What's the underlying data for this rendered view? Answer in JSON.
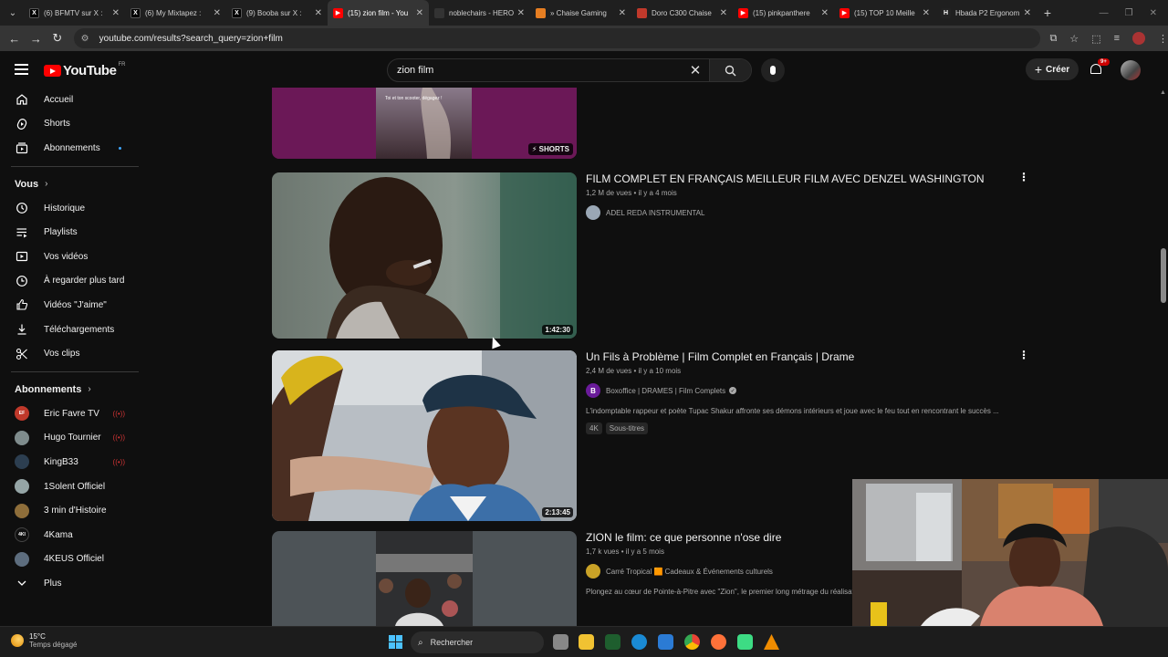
{
  "browser": {
    "tabs": [
      {
        "title": "(6) BFMTV sur X :",
        "icon": "x-icon",
        "active": false
      },
      {
        "title": "(6) My Mixtapez :",
        "icon": "x-icon",
        "active": false
      },
      {
        "title": "(9) Booba sur X :",
        "icon": "x-icon",
        "active": false
      },
      {
        "title": "(15) zion film - You",
        "icon": "youtube-icon",
        "active": true
      },
      {
        "title": "noblechairs - HERO",
        "icon": "noblechairs-icon",
        "active": false
      },
      {
        "title": "» Chaise Gaming",
        "icon": "chaise-gaming-icon",
        "active": false
      },
      {
        "title": "Doro C300 Chaise",
        "icon": "doro-icon",
        "active": false
      },
      {
        "title": "(15) pinkpanthere",
        "icon": "youtube-icon",
        "active": false
      },
      {
        "title": "(15) TOP 10 Meille",
        "icon": "youtube-icon",
        "active": false
      },
      {
        "title": "Hbada P2 Ergonom",
        "icon": "hbada-icon",
        "active": false
      }
    ],
    "url": "youtube.com/results?search_query=zion+film"
  },
  "header": {
    "logo_text": "YouTube",
    "country": "FR",
    "search_value": "zion film",
    "create_label": "Créer",
    "notifications_badge": "9+"
  },
  "sidebar": {
    "main": [
      {
        "label": "Accueil",
        "icon": "home-icon"
      },
      {
        "label": "Shorts",
        "icon": "shorts-icon"
      },
      {
        "label": "Abonnements",
        "icon": "subscriptions-icon"
      }
    ],
    "you_heading": "Vous",
    "you_items": [
      {
        "label": "Historique",
        "icon": "history-icon"
      },
      {
        "label": "Playlists",
        "icon": "playlists-icon"
      },
      {
        "label": "Vos vidéos",
        "icon": "your-videos-icon"
      },
      {
        "label": "À regarder plus tard",
        "icon": "watch-later-icon"
      },
      {
        "label": "Vidéos \"J'aime\"",
        "icon": "liked-videos-icon"
      },
      {
        "label": "Téléchargements",
        "icon": "downloads-icon"
      },
      {
        "label": "Vos clips",
        "icon": "clips-icon"
      }
    ],
    "subs_heading": "Abonnements",
    "subscriptions": [
      {
        "label": "Eric Favre TV",
        "live": true,
        "avatar_color": "#c0392b",
        "avatar_text": "EF"
      },
      {
        "label": "Hugo Tournier",
        "live": true,
        "avatar_color": "#7f8c8d",
        "avatar_text": ""
      },
      {
        "label": "KingB33",
        "live": true,
        "avatar_color": "#2c3e50",
        "avatar_text": ""
      },
      {
        "label": "1Solent Officiel",
        "live": false,
        "avatar_color": "#95a5a6",
        "avatar_text": ""
      },
      {
        "label": "3 min d'Histoire",
        "live": false,
        "avatar_color": "#8e6e3a",
        "avatar_text": ""
      },
      {
        "label": "4Kama",
        "live": false,
        "avatar_color": "#111111",
        "avatar_text": "4KI"
      },
      {
        "label": "4KEUS Officiel",
        "live": false,
        "avatar_color": "#5d6d7e",
        "avatar_text": ""
      }
    ],
    "more_label": "Plus"
  },
  "results": [
    {
      "kind": "short",
      "shorts_label": "SHORTS",
      "overlay_text": "Toi et ton scooter, dégagez !"
    },
    {
      "title": "FILM COMPLET EN FRANÇAIS MEILLEUR FILM AVEC DENZEL WASHINGTON",
      "views": "1,2 M de vues",
      "age": "il y a 4 mois",
      "channel": "ADEL REDA INSTRUMENTAL",
      "verified": false,
      "channel_color": "#9aa7b5",
      "channel_initial": "",
      "duration": "1:42:30",
      "description": "",
      "chips": []
    },
    {
      "title": "Un Fils à Problème | Film Complet en Français | Drame",
      "views": "2,4 M de vues",
      "age": "il y a 10 mois",
      "channel": "Boxoffice | DRAMES | Film Complets",
      "verified": true,
      "channel_color": "#6a1b9a",
      "channel_initial": "B",
      "duration": "2:13:45",
      "description": "L'indomptable rappeur et poète Tupac Shakur affronte ses démons intérieurs et joue avec le feu tout en rencontrant le succès ...",
      "chips": [
        "4K",
        "Sous-titres"
      ]
    },
    {
      "title": "ZION le film: ce que personne n'ose dire",
      "views": "1,7 k vues",
      "age": "il y a 5 mois",
      "channel": "Carré Tropical 🟧 Cadeaux & Événements culturels",
      "verified": false,
      "channel_color": "#c9a227",
      "channel_initial": "",
      "duration": "",
      "description": "Plongez au cœur de Pointe-à-Pitre avec \"Zion\", le premier long métrage du réalisate",
      "chips": []
    }
  ],
  "taskbar": {
    "temperature": "15°C",
    "weather": "Temps dégagé",
    "search_label": "Rechercher"
  }
}
